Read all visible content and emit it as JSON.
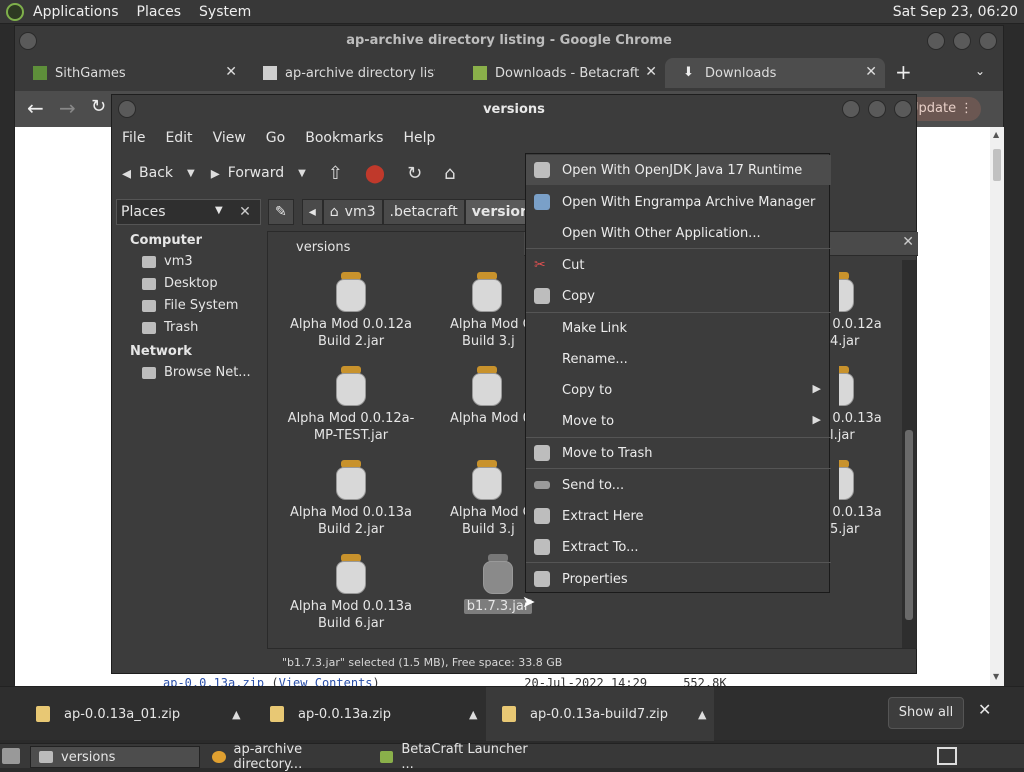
{
  "top_panel": {
    "menus": [
      "Applications",
      "Places",
      "System"
    ],
    "clock": "Sat Sep 23, 06:20"
  },
  "chrome": {
    "window_title": "ap-archive directory listing - Google Chrome",
    "tabs": [
      {
        "label": "SithGames",
        "icon": "minecraft-grass-icon"
      },
      {
        "label": "ap-archive directory listing",
        "icon": "archive-building-icon"
      },
      {
        "label": "Downloads - Betacraft",
        "icon": "betacraft-icon"
      },
      {
        "label": "Downloads",
        "icon": "download-icon"
      }
    ],
    "new_tab": "+",
    "update_label": "Update",
    "listing_line": {
      "file": "ap-0.0.13a.zip",
      "link": "View Contents",
      "date": "20-Jul-2022 14:29",
      "size": "552.8K"
    }
  },
  "file_manager": {
    "title": "versions",
    "menubar": [
      "File",
      "Edit",
      "View",
      "Go",
      "Bookmarks",
      "Help"
    ],
    "toolbar": {
      "back": "Back",
      "forward": "Forward"
    },
    "side_selector": "Places",
    "sidebar": {
      "computer_heading": "Computer",
      "computer_items": [
        "vm3",
        "Desktop",
        "File System",
        "Trash"
      ],
      "network_heading": "Network",
      "network_items": [
        "Browse Net..."
      ]
    },
    "path": [
      "vm3",
      ".betacraft",
      "versions"
    ],
    "folder_label": "versions",
    "files": [
      {
        "line1": "Alpha Mod 0.0.12a",
        "line2": "Build 2.jar"
      },
      {
        "line1": "Alpha Mod 0.0.12a-",
        "line2": "MP-TEST.jar"
      },
      {
        "line1": "Alpha Mod 0.0.13a",
        "line2": "Build 2.jar"
      },
      {
        "line1": "Alpha Mod 0.0.13a",
        "line2": "Build 6.jar"
      },
      {
        "line1": "Alpha Mod C",
        "line2": "Build 3.j"
      },
      {
        "line1": "Alpha Mod 0.",
        "line2": ""
      },
      {
        "line1": "Alpha Mod C",
        "line2": "Build 3.j"
      },
      {
        "line1": "b1.7.3.jar",
        "line2": ""
      },
      {
        "line1": "d 0.0.12a",
        "line2": "4.jar"
      },
      {
        "line1": "d 0.0.13a",
        "line2": "l.jar"
      },
      {
        "line1": "d 0.0.13a",
        "line2": "5.jar"
      }
    ],
    "status": "\"b1.7.3.jar\" selected (1.5 MB), Free space: 33.8 GB"
  },
  "context_menu": {
    "items": [
      "Open With OpenJDK Java 17 Runtime",
      "Open With Engrampa Archive Manager",
      "Open With Other Application...",
      "Cut",
      "Copy",
      "Make Link",
      "Rename...",
      "Copy to",
      "Move to",
      "Move to Trash",
      "Send to...",
      "Extract Here",
      "Extract To...",
      "Properties"
    ]
  },
  "downloads_bar": {
    "items": [
      "ap-0.0.13a_01.zip",
      "ap-0.0.13a.zip",
      "ap-0.0.13a-build7.zip"
    ],
    "show_all": "Show all"
  },
  "taskbar": {
    "tasks": [
      "versions",
      "ap-archive directory...",
      "BetaCraft Launcher ..."
    ]
  }
}
